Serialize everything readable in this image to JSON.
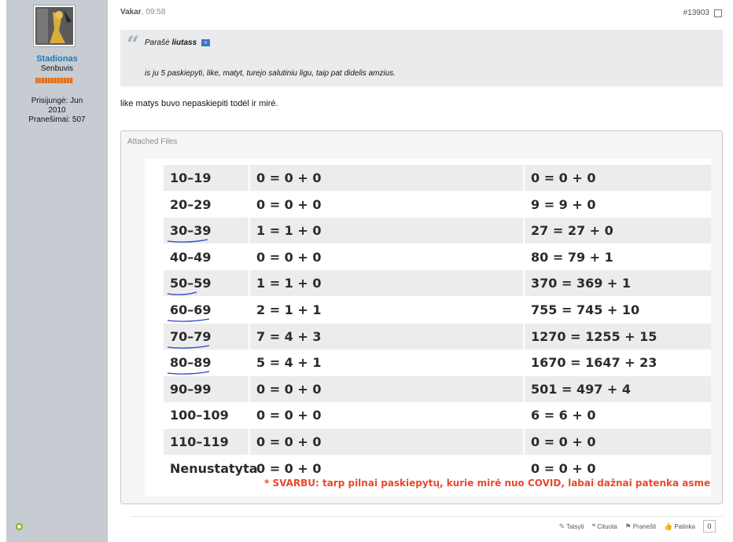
{
  "user": {
    "name": "Stadionas",
    "title": "Senbuvis",
    "joined_line1": "Prisijungė: Jun",
    "joined_line2": "2010",
    "posts": "Pranešimai: 507"
  },
  "post": {
    "date_label": "Vakar",
    "time": ", 09:58",
    "number": "#13903",
    "quote_prefix": "Parašė",
    "quote_author": "liutass",
    "quote_text": "is ju 5 paskiepyti, like, matyt, turejo salutiniu ligu, taip pat didelis amzius.",
    "body": "like matys buvo nepaskiepiti todėl ir mirė."
  },
  "attachments": {
    "title": "Attached Files",
    "rows": [
      {
        "age": "10–19",
        "a": "0 = 0 + 0",
        "b": "0 = 0 + 0"
      },
      {
        "age": "20–29",
        "a": "0 = 0 + 0",
        "b": "9 = 9 + 0"
      },
      {
        "age": "30–39",
        "a": "1 = 1 + 0",
        "b": "27 = 27 + 0"
      },
      {
        "age": "40–49",
        "a": "0 = 0 + 0",
        "b": "80 = 79 + 1"
      },
      {
        "age": "50–59",
        "a": "1 = 1 + 0",
        "b": "370 = 369 + 1"
      },
      {
        "age": "60–69",
        "a": "2 = 1 + 1",
        "b": "755 = 745 + 10"
      },
      {
        "age": "70–79",
        "a": "7 = 4 + 3",
        "b": "1270 = 1255 + 15"
      },
      {
        "age": "80–89",
        "a": "5 = 4 + 1",
        "b": "1670 = 1647 + 23"
      },
      {
        "age": "90–99",
        "a": "0 = 0 + 0",
        "b": "501 = 497 + 4"
      },
      {
        "age": "100–109",
        "a": "0 = 0 + 0",
        "b": "6 = 6 + 0"
      },
      {
        "age": "110–119",
        "a": "0 = 0 + 0",
        "b": "0 = 0 + 0"
      },
      {
        "age": "Nenustatyta",
        "a": "0 = 0 + 0",
        "b": "0 = 0 + 0"
      }
    ],
    "note": "* SVARBU: tarp pilnai paskiepytų, kurie mirė nuo COVID, labai dažnai patenka asmenys su imunosu",
    "colors": {
      "note": "#e8492f",
      "underline": "#2b3fc9"
    }
  },
  "actions": {
    "edit": "Taisyti",
    "quote": "Cituota",
    "report": "Pranešti",
    "like": "Patinka",
    "like_count": "0"
  }
}
